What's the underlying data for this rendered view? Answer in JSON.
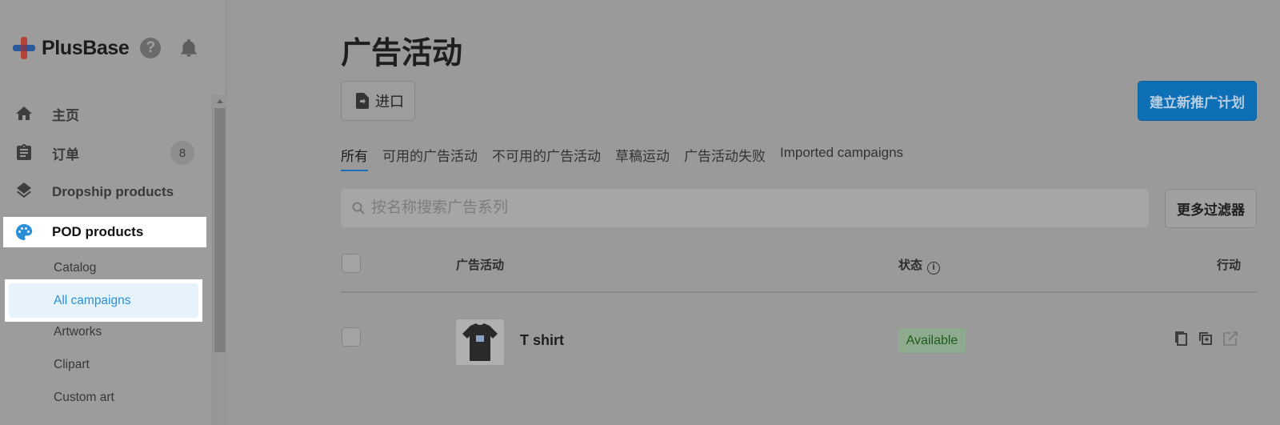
{
  "sidebar": {
    "brand": "PlusBase",
    "help_symbol": "?",
    "items": [
      {
        "label": "主页",
        "icon": "home-icon"
      },
      {
        "label": "订单",
        "icon": "clipboard-icon",
        "count": "8"
      },
      {
        "label": "Dropship products",
        "icon": "layers-icon"
      },
      {
        "label": "POD products",
        "icon": "palette-icon"
      }
    ],
    "sub_items": [
      "Catalog",
      "All campaigns",
      "Artworks",
      "Clipart",
      "Custom art"
    ]
  },
  "main": {
    "title": "广告活动",
    "import_label": "进口",
    "create_label": "建立新推广计划",
    "tabs": [
      "所有",
      "可用的广告活动",
      "不可用的广告活动",
      "草稿运动",
      "广告活动失败",
      "Imported campaigns"
    ],
    "search_placeholder": "按名称搜索广告系列",
    "filter_label": "更多过滤器",
    "table": {
      "headers": {
        "campaign": "广告活动",
        "status": "状态",
        "action": "行动"
      },
      "rows": [
        {
          "name": "T shirt",
          "status": "Available"
        }
      ]
    }
  },
  "colors": {
    "accent": "#0d6fb5",
    "active_link": "#2b8fd6",
    "available_badge": "#8fab8f"
  }
}
